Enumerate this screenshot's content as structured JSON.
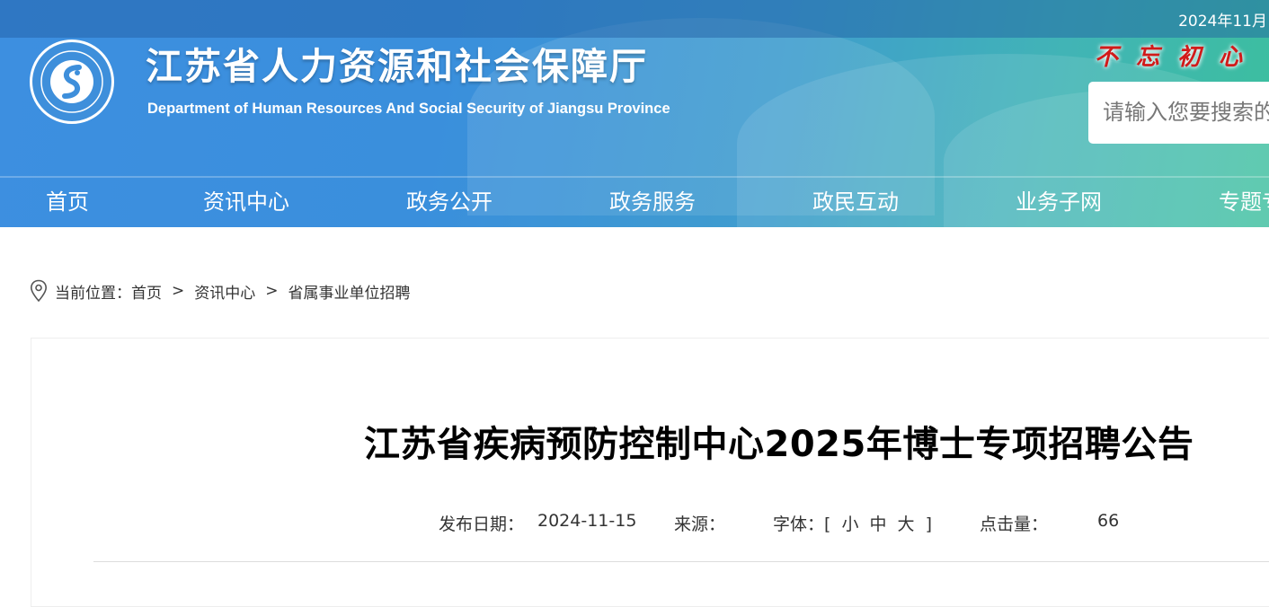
{
  "header": {
    "date": "2024年11月",
    "title": "江苏省人力资源和社会保障厅",
    "subtitle": "Department of Human Resources And Social Security of Jiangsu Province",
    "slogan": "不忘初心",
    "search_placeholder": "请输入您要搜索的"
  },
  "nav": {
    "items": [
      "首页",
      "资讯中心",
      "政务公开",
      "政务服务",
      "政民互动",
      "业务子网",
      "专题专"
    ]
  },
  "breadcrumb": {
    "prefix": "当前位置：",
    "items": [
      "首页",
      "资讯中心",
      "省属事业单位招聘"
    ],
    "separator": ">"
  },
  "article": {
    "title": "江苏省疾病预防控制中心2025年博士专项招聘公告",
    "date_label": "发布日期：",
    "date": "2024-11-15",
    "source_label": "来源：",
    "source": "",
    "font_label": "字体：",
    "font_open": "[",
    "font_small": "小",
    "font_medium": "中",
    "font_large": "大",
    "font_close": "]",
    "hits_label": "点击量：",
    "hits": "66"
  },
  "colors": {
    "header_start": "#3d8fe0",
    "header_end": "#3cbf9e",
    "slogan": "#d11a1a"
  }
}
